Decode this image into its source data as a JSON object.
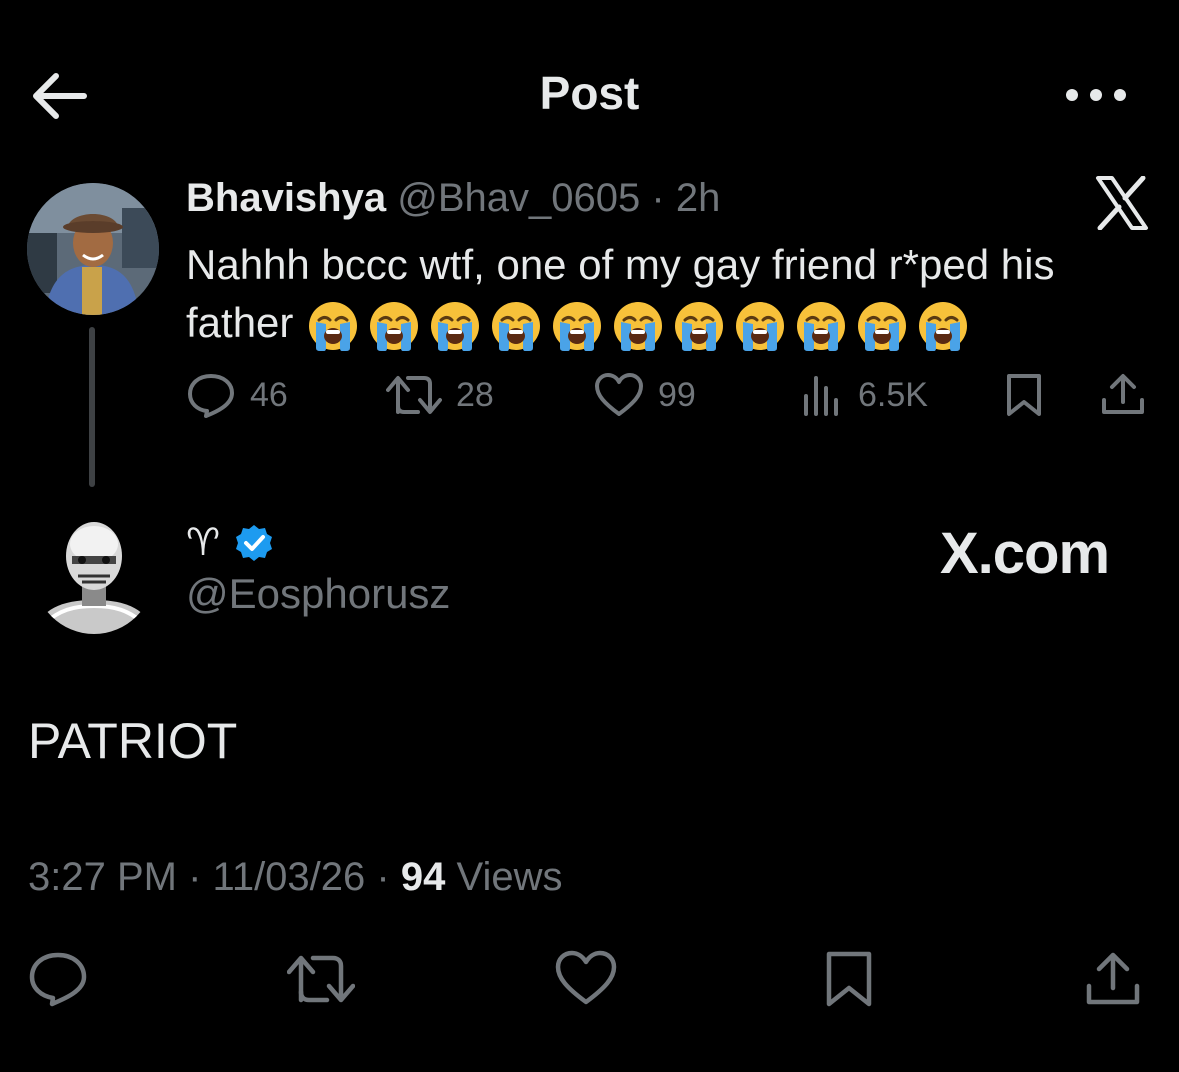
{
  "header": {
    "title": "Post",
    "back_icon": "arrow-left-icon",
    "more_icon": "more-horizontal-icon"
  },
  "quoted": {
    "display_name": "Bhavishya",
    "handle": "@Bhav_0605",
    "separator": "·",
    "time": "2h",
    "text": "Nahhh bccc wtf, one of my gay friend r*ped his father",
    "emoji_icon": "loudly-crying-face-icon",
    "emoji_count": 11,
    "stats": {
      "replies": "46",
      "reposts": "28",
      "likes": "99",
      "views": "6.5K"
    }
  },
  "tweet": {
    "display_name": "♈",
    "verified": true,
    "handle": "@Eosphorusz",
    "watermark": "X.com",
    "text": "PATRIOT",
    "time": "3:27 PM",
    "date": "11/03/26",
    "separator": "·",
    "views_count": "94",
    "views_label": "Views"
  },
  "colors": {
    "background": "#000000",
    "text": "#e7e9ea",
    "muted": "#71767b",
    "verified": "#1d9bf0",
    "emoji_face": "#f7c13a"
  }
}
